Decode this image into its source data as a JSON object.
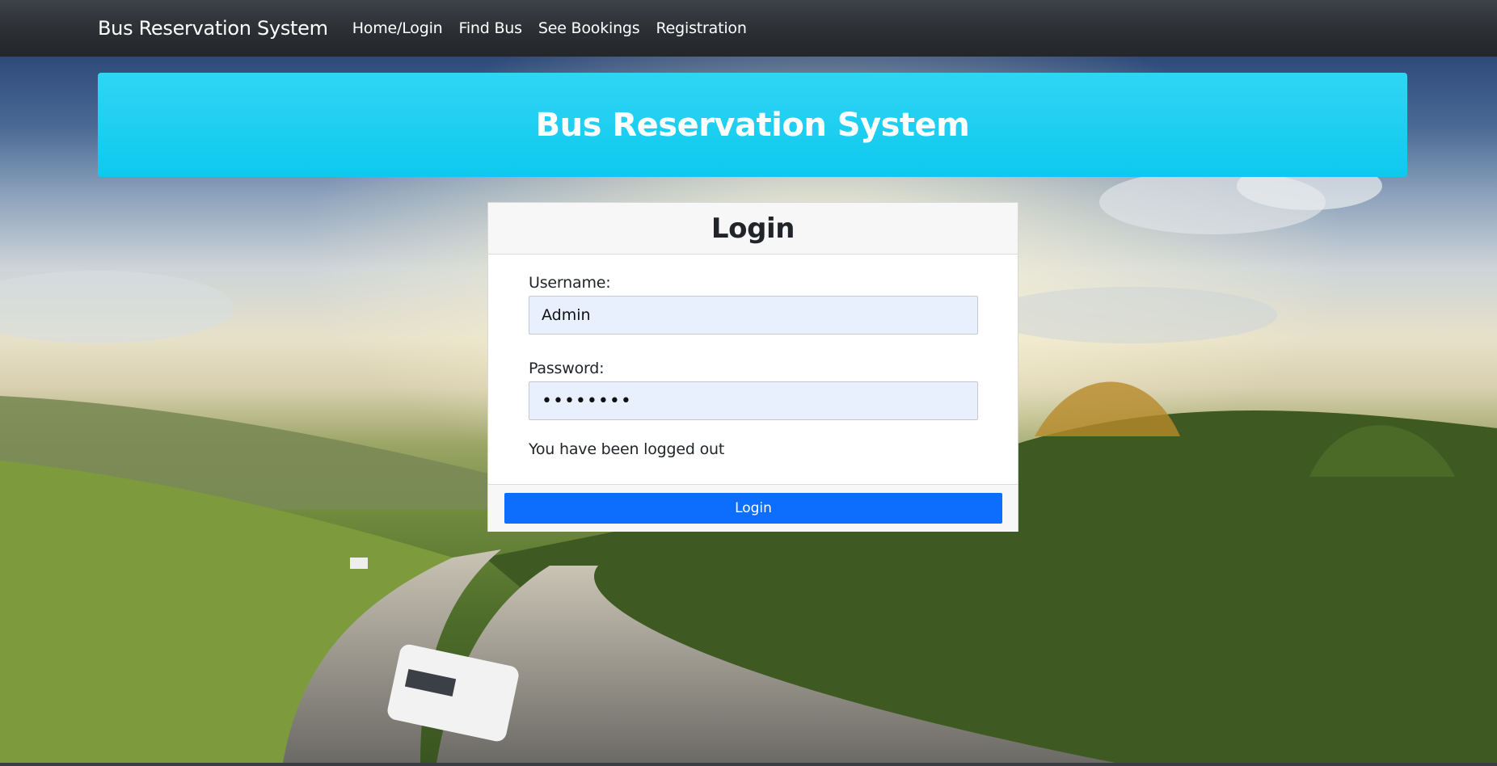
{
  "navbar": {
    "brand": "Bus Reservation System",
    "links": [
      "Home/Login",
      "Find Bus",
      "See Bookings",
      "Registration"
    ]
  },
  "hero": {
    "title": "Bus Reservation System"
  },
  "login": {
    "title": "Login",
    "username_label": "Username:",
    "username_value": "Admin",
    "password_label": "Password:",
    "password_value": "********",
    "status": "You have been logged out",
    "submit_label": "Login"
  },
  "colors": {
    "navbar": "#2a2d31",
    "hero": "#0dcaf0",
    "primary_button": "#0d6efd",
    "autofill_input": "#e8f0fe"
  }
}
